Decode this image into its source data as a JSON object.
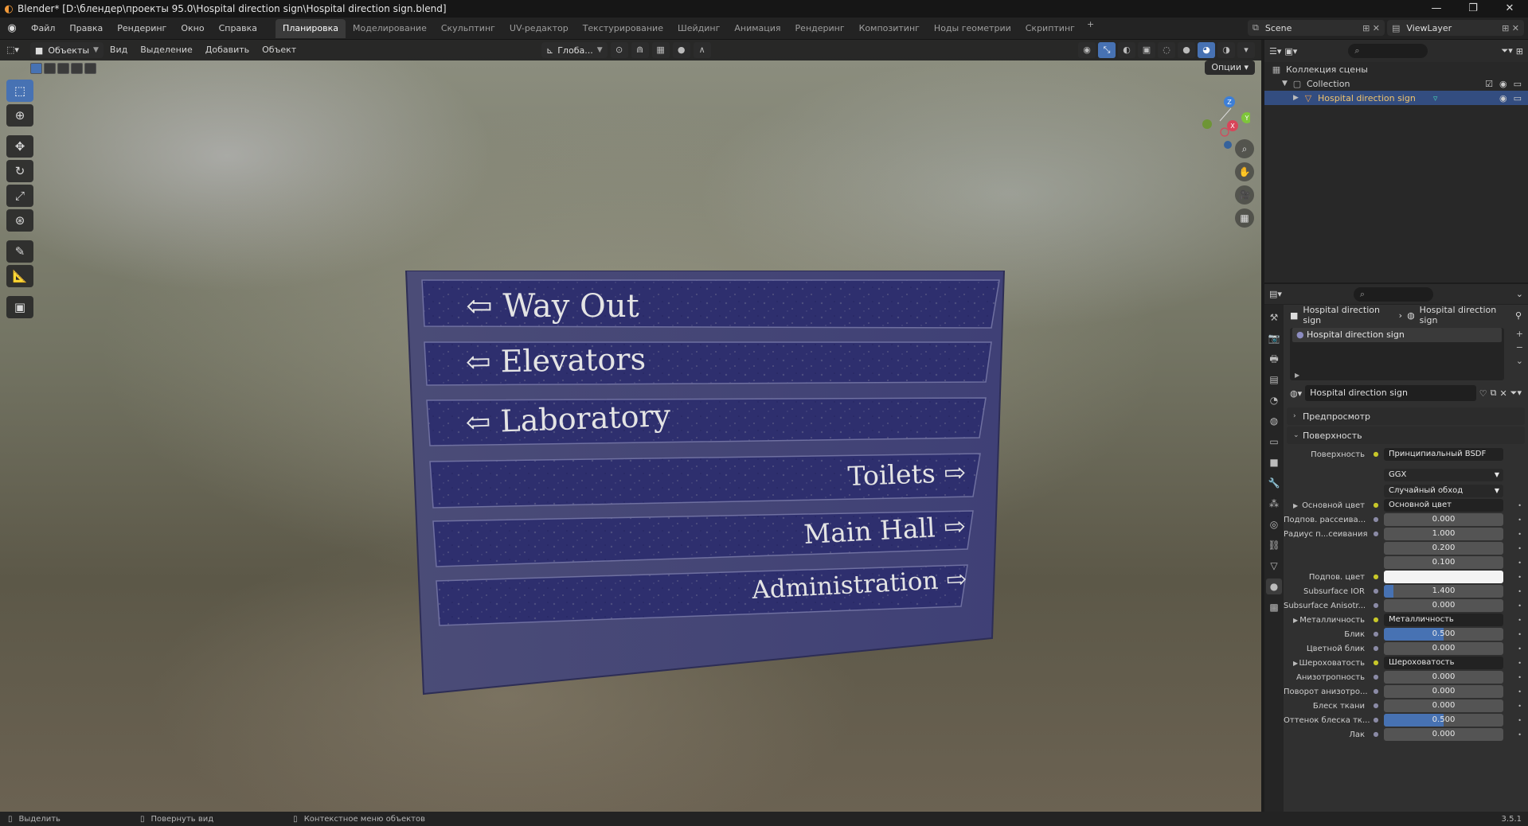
{
  "window": {
    "title": "Blender* [D:\\блендер\\проекты 95.0\\Hospital direction sign\\Hospital direction sign.blend]",
    "controls": [
      "—",
      "❐",
      "✕"
    ]
  },
  "menu": [
    "Файл",
    "Правка",
    "Рендеринг",
    "Окно",
    "Справка"
  ],
  "workspaces": [
    "Планировка",
    "Моделирование",
    "Скульптинг",
    "UV-редактор",
    "Текстурирование",
    "Шейдинг",
    "Анимация",
    "Рендеринг",
    "Композитинг",
    "Ноды геометрии",
    "Скриптинг"
  ],
  "workspace_add": "+",
  "scene": "Scene",
  "view_layer": "ViewLayer",
  "viewport": {
    "mode": "Объекты",
    "menus": [
      "Вид",
      "Выделение",
      "Добавить",
      "Объект"
    ],
    "transform_orientation": "Глоба...",
    "options_label": "Опции",
    "gizmo": {
      "x": "X",
      "y": "Y",
      "z": "Z"
    }
  },
  "sign": {
    "rows": [
      {
        "text": "Way Out",
        "arrow": "left"
      },
      {
        "text": "Elevators",
        "arrow": "left"
      },
      {
        "text": "Laboratory",
        "arrow": "left"
      },
      {
        "text": "Toilets",
        "arrow": "right"
      },
      {
        "text": "Main Hall",
        "arrow": "right"
      },
      {
        "text": "Administration",
        "arrow": "right"
      }
    ]
  },
  "outliner": {
    "scene_collection": "Коллекция сцены",
    "collection": "Collection",
    "object": "Hospital direction sign"
  },
  "properties": {
    "breadcrumb_object": "Hospital direction sign",
    "breadcrumb_material": "Hospital direction sign",
    "slot_name": "Hospital direction sign",
    "material_name": "Hospital direction sign",
    "sections": {
      "preview": "Предпросмотр",
      "surface": "Поверхность"
    },
    "surface_label": "Поверхность",
    "surface_value": "Принципиальный BSDF",
    "distribution": "GGX",
    "subsurface_method": "Случайный обход",
    "rows": [
      {
        "label": "Основной цвет",
        "value": "Основной цвет",
        "type": "link",
        "expand": true
      },
      {
        "label": "Подпов. рассеива...",
        "value": "0.000",
        "type": "num",
        "fill": 0
      },
      {
        "label": "Радиус п...сеивания",
        "value": "1.000",
        "type": "num",
        "fill": 0
      },
      {
        "label": "",
        "value": "0.200",
        "type": "num",
        "fill": 0
      },
      {
        "label": "",
        "value": "0.100",
        "type": "num",
        "fill": 0
      },
      {
        "label": "Подпов. цвет",
        "value": "",
        "type": "color"
      },
      {
        "label": "Subsurface IOR",
        "value": "1.400",
        "type": "num",
        "fill": 0.08
      },
      {
        "label": "Subsurface Anisotr...",
        "value": "0.000",
        "type": "num",
        "fill": 0
      },
      {
        "label": "Металличность",
        "value": "Металличность",
        "type": "link",
        "expand": true
      },
      {
        "label": "Блик",
        "value": "0.500",
        "type": "num",
        "fill": 0.5
      },
      {
        "label": "Цветной блик",
        "value": "0.000",
        "type": "num",
        "fill": 0
      },
      {
        "label": "Шероховатость",
        "value": "Шероховатость",
        "type": "link",
        "expand": true
      },
      {
        "label": "Анизотропность",
        "value": "0.000",
        "type": "num",
        "fill": 0
      },
      {
        "label": "Поворот анизотро...",
        "value": "0.000",
        "type": "num",
        "fill": 0
      },
      {
        "label": "Блеск ткани",
        "value": "0.000",
        "type": "num",
        "fill": 0
      },
      {
        "label": "Оттенок блеска тк...",
        "value": "0.500",
        "type": "num",
        "fill": 0.5
      },
      {
        "label": "Лак",
        "value": "0.000",
        "type": "num",
        "fill": 0
      }
    ]
  },
  "statusbar": {
    "select": "Выделить",
    "rotate": "Повернуть вид",
    "context": "Контекстное меню объектов",
    "version": "3.5.1"
  },
  "colors": {
    "accent": "#4772b3",
    "sign_blue": "#2e2f6e",
    "selected_object": "#f0c36c"
  }
}
